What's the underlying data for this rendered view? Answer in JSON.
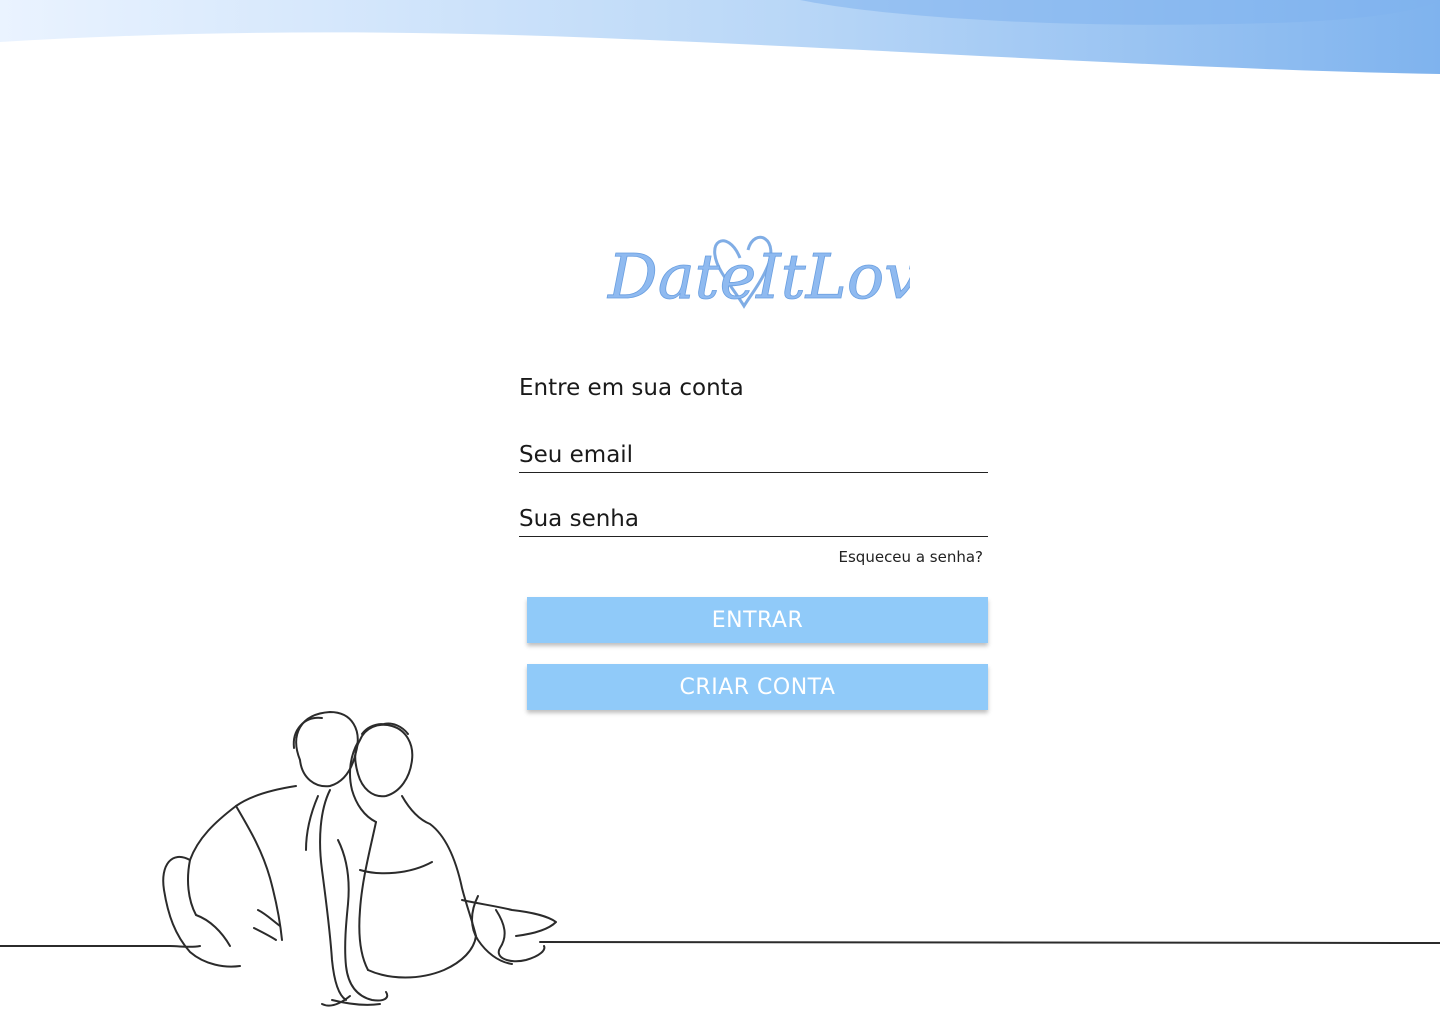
{
  "brand": {
    "logo_text": "DateItLove",
    "accent": "#90caf9",
    "wave_dark": "#7fb3ee",
    "wave_light": "#e3efff"
  },
  "login": {
    "title": "Entre em sua conta",
    "email_placeholder": "Seu email",
    "password_placeholder": "Sua senha",
    "forgot_label": "Esqueceu a senha?",
    "login_label": "ENTRAR",
    "signup_label": "CRIAR CONTA"
  },
  "illustration": {
    "icon": "couple-line-art-icon"
  }
}
